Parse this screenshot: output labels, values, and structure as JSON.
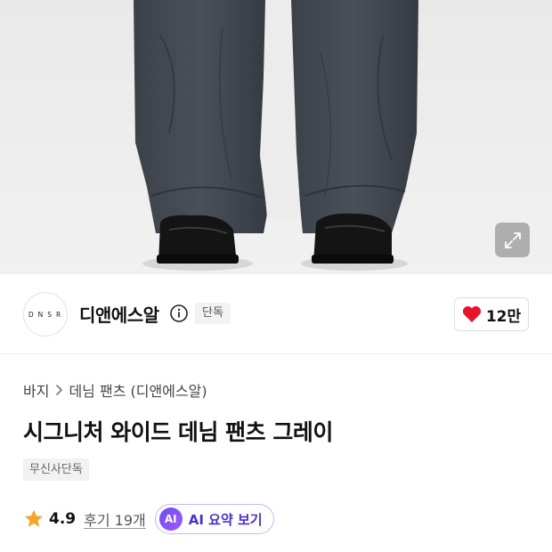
{
  "brand": {
    "logo_text": "DNSR",
    "name": "디앤에스알",
    "badge": "단독"
  },
  "like": {
    "count": "12만"
  },
  "breadcrumb": {
    "category": "바지",
    "subcategory": "데님 팬츠 (디앤에스알)"
  },
  "product": {
    "title": "시그니처 와이드 데님 팬츠 그레이",
    "tag": "무신사단독"
  },
  "rating": {
    "score": "4.9",
    "reviews_label": "후기 19개"
  },
  "ai_summary": {
    "badge": "AI",
    "label": "AI 요약 보기"
  },
  "colors": {
    "heart": "#e8142a",
    "star": "#f5a623",
    "ai_accent": "#6f4cf5"
  },
  "icons": [
    "expand-icon",
    "info-icon",
    "heart-icon",
    "chevron-right-icon",
    "star-icon"
  ]
}
